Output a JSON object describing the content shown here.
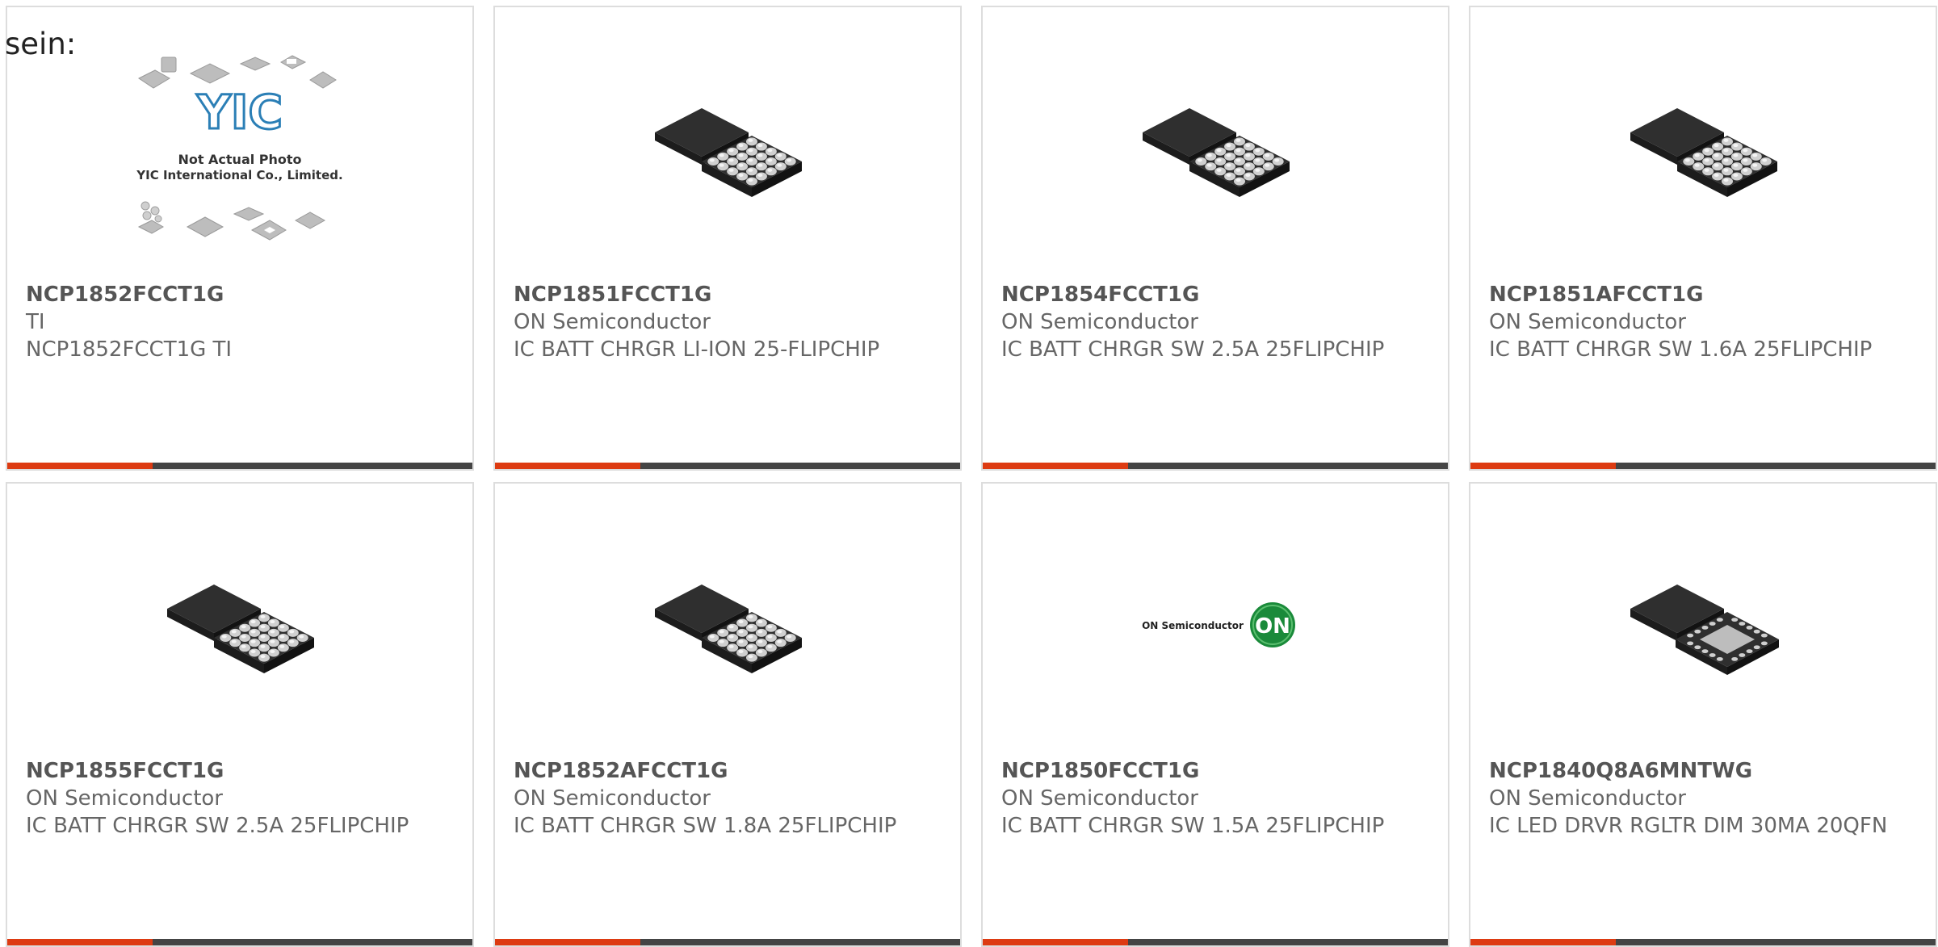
{
  "lead_text": "sein:",
  "placeholder_image": {
    "line1": "Not Actual Photo",
    "line2": "YIC International Co., Limited.",
    "logo_text": "YIC"
  },
  "on_logo": {
    "wordmark": "ON Semiconductor",
    "badge": "ON"
  },
  "colors": {
    "accent": "#dd3b12",
    "bar": "#444444",
    "text": "#666666",
    "border": "#dddddd"
  },
  "products": [
    {
      "part": "NCP1852FCCT1G",
      "manufacturer": "TI",
      "description": "NCP1852FCCT1G TI",
      "image": "placeholder"
    },
    {
      "part": "NCP1851FCCT1G",
      "manufacturer": "ON Semiconductor",
      "description": "IC BATT CHRGR LI-ION 25-FLIPCHIP",
      "image": "bga-chip"
    },
    {
      "part": "NCP1854FCCT1G",
      "manufacturer": "ON Semiconductor",
      "description": "IC BATT CHRGR SW 2.5A 25FLIPCHIP",
      "image": "bga-chip"
    },
    {
      "part": "NCP1851AFCCT1G",
      "manufacturer": "ON Semiconductor",
      "description": "IC BATT CHRGR SW 1.6A 25FLIPCHIP",
      "image": "bga-chip"
    },
    {
      "part": "NCP1855FCCT1G",
      "manufacturer": "ON Semiconductor",
      "description": "IC BATT CHRGR SW 2.5A 25FLIPCHIP",
      "image": "bga-chip"
    },
    {
      "part": "NCP1852AFCCT1G",
      "manufacturer": "ON Semiconductor",
      "description": "IC BATT CHRGR SW 1.8A 25FLIPCHIP",
      "image": "bga-chip"
    },
    {
      "part": "NCP1850FCCT1G",
      "manufacturer": "ON Semiconductor",
      "description": "IC BATT CHRGR SW 1.5A 25FLIPCHIP",
      "image": "on-logo"
    },
    {
      "part": "NCP1840Q8A6MNTWG",
      "manufacturer": "ON Semiconductor",
      "description": "IC LED DRVR RGLTR DIM 30MA 20QFN",
      "image": "qfn-chip"
    }
  ]
}
